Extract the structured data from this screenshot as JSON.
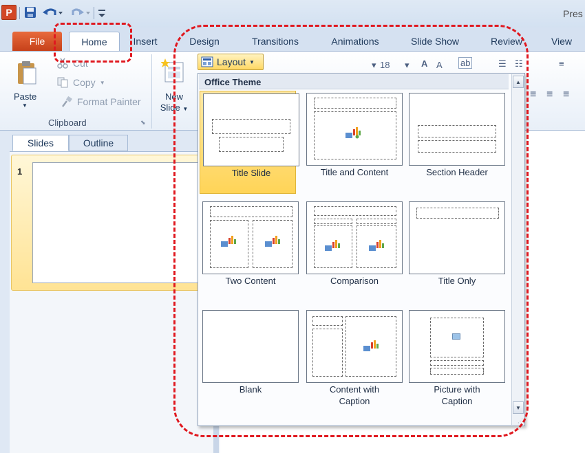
{
  "titlebar": {
    "app_icon_letter": "P",
    "window_title": "Pres"
  },
  "tabs": [
    "File",
    "Home",
    "Insert",
    "Design",
    "Transitions",
    "Animations",
    "Slide Show",
    "Review",
    "View"
  ],
  "ribbon": {
    "paste_label": "Paste",
    "cut_label": "Cut",
    "copy_label": "Copy",
    "format_painter_label": "Format Painter",
    "clipboard_group_label": "Clipboard",
    "new_slide_label_1": "New",
    "new_slide_label_2": "Slide",
    "layout_label": "Layout",
    "font_size_value": "18"
  },
  "slides_pane": {
    "tabs": [
      "Slides",
      "Outline"
    ],
    "slide_number": "1"
  },
  "layout_gallery": {
    "header": "Office Theme",
    "selected": "Title Slide",
    "layouts": [
      "Title Slide",
      "Title and Content",
      "Section Header",
      "Two Content",
      "Comparison",
      "Title Only",
      "Blank",
      "Content with\nCaption",
      "Picture with\nCaption"
    ]
  },
  "colors": {
    "highlight": "#e0181f",
    "file_tab": "#c6411a",
    "selected_layout": "#ffd457",
    "ribbon_text": "#1e395b"
  }
}
